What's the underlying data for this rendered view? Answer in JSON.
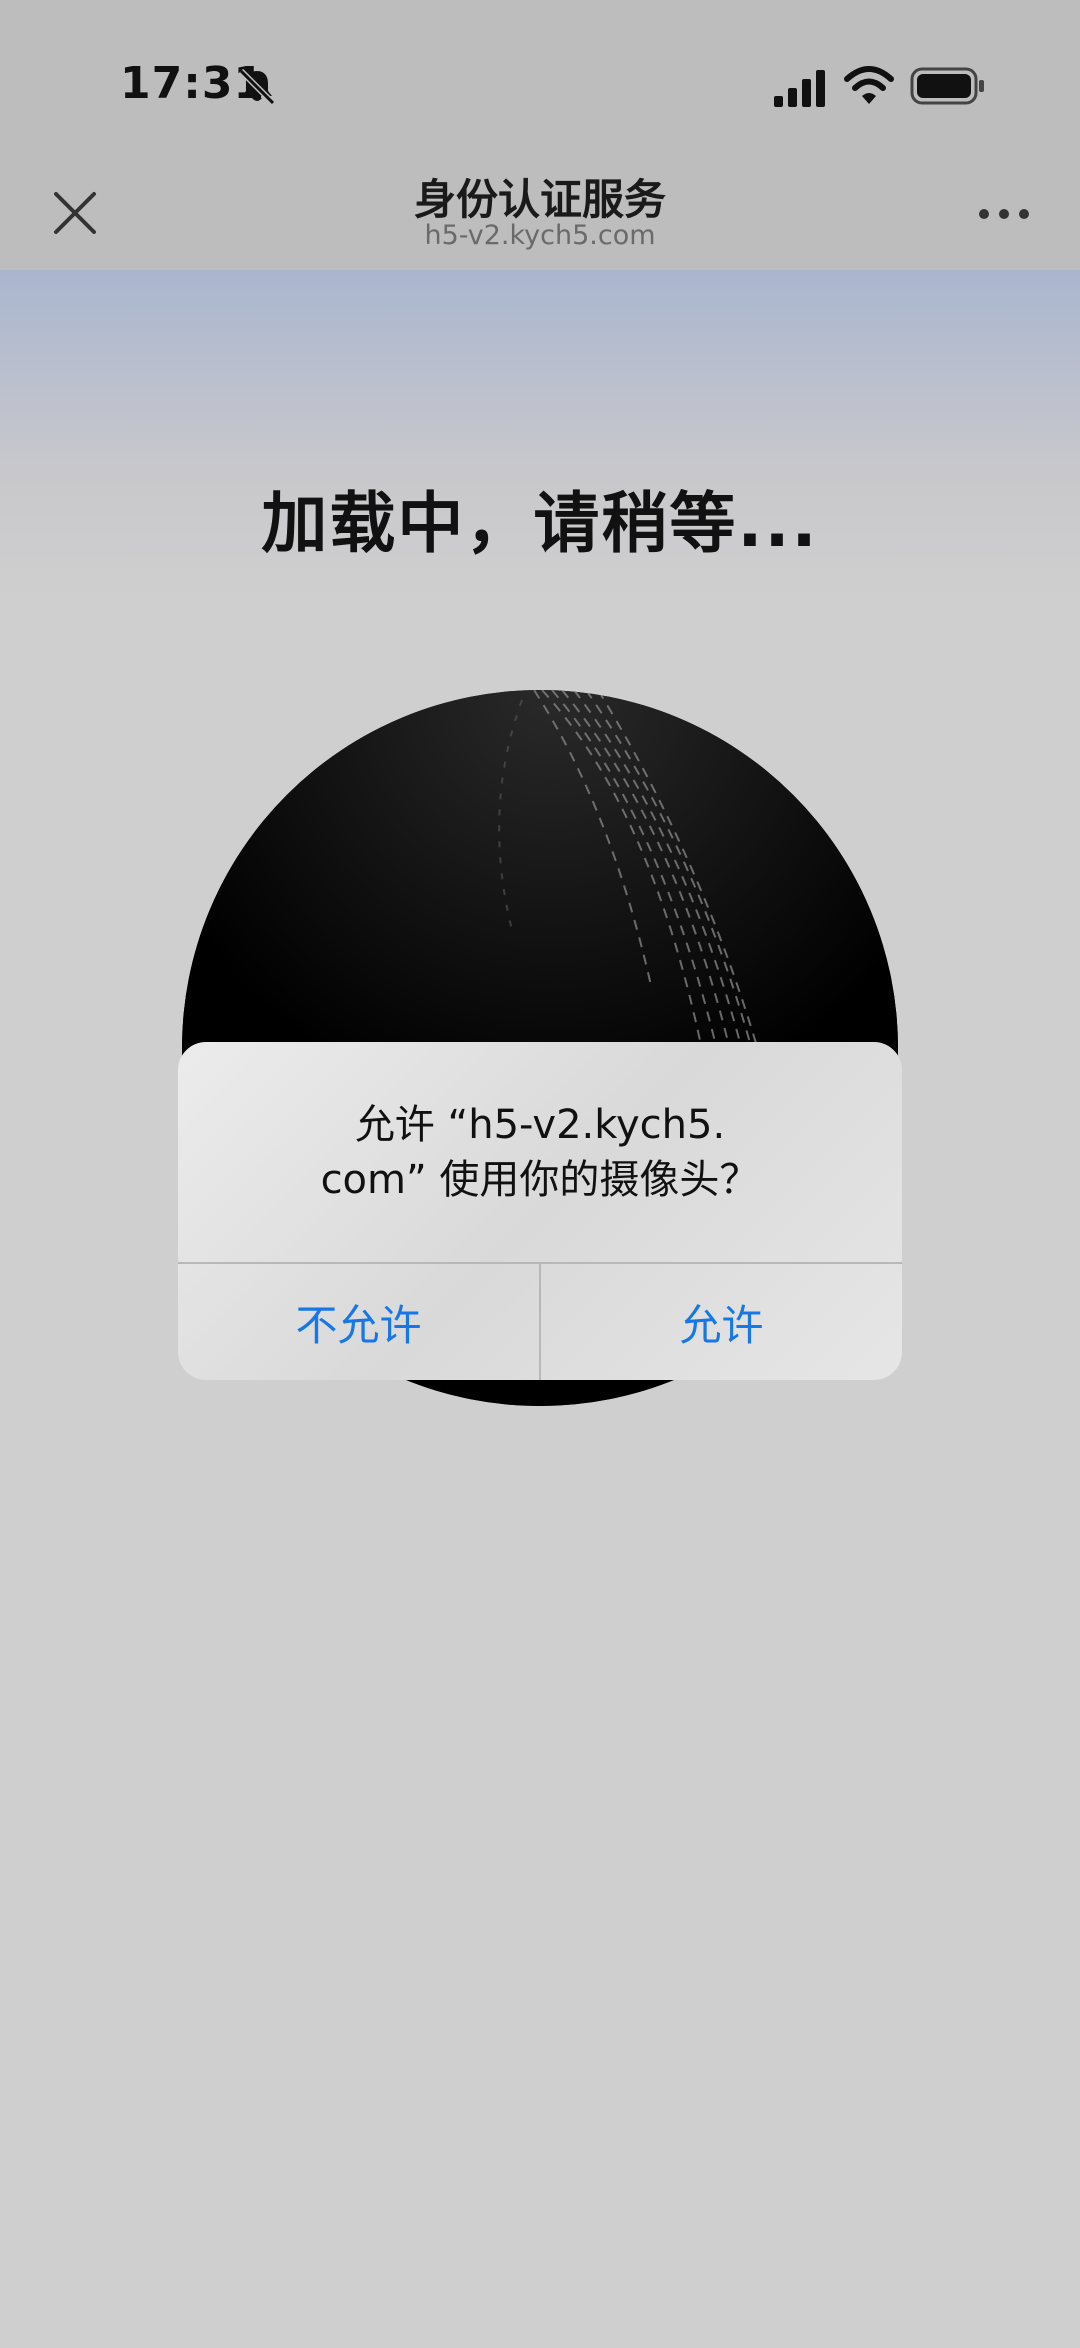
{
  "status_bar": {
    "time": "17:31",
    "icons": [
      "bell-slash-icon",
      "cellular-signal-icon",
      "wifi-icon",
      "battery-icon"
    ]
  },
  "nav_bar": {
    "title": "身份认证服务",
    "subtitle": "h5-v2.kych5.com",
    "left_icon": "close-icon",
    "right_icon": "more-icon"
  },
  "content": {
    "loading_text": "加载中，请稍等..."
  },
  "alert": {
    "message_line1": "允许 “h5-v2.kych5.",
    "message_line2": "com” 使用你的摄像头？",
    "deny_label": "不允许",
    "allow_label": "允许"
  },
  "colors": {
    "accent": "#1877e6",
    "background": "#cfcfcf",
    "bar_background": "#bdbdbd"
  }
}
